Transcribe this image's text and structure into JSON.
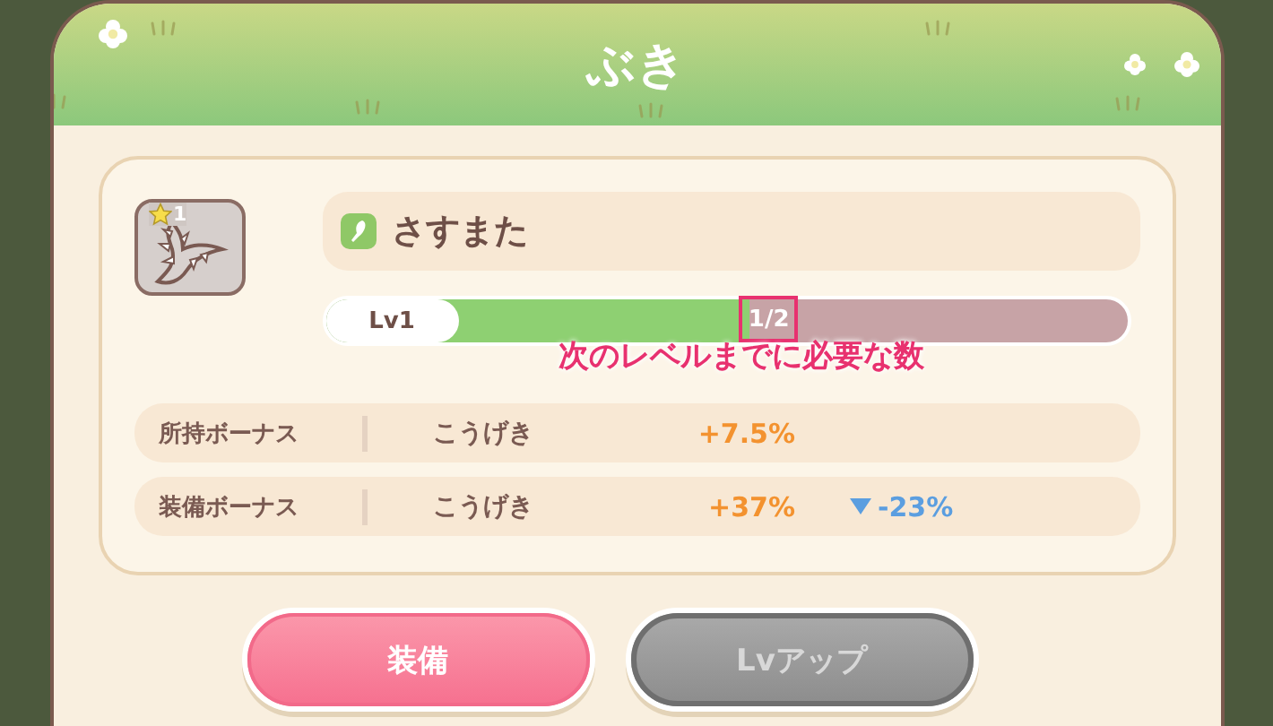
{
  "dialog": {
    "title": "ぶき"
  },
  "item": {
    "rarity": "1",
    "name": "さすまた",
    "level_label": "Lv1",
    "progress": {
      "level": 0.53,
      "count": "1/2",
      "highlighted": true
    },
    "annotation": "次のレベルまでに必要な数"
  },
  "bonuses": [
    {
      "label": "所持ボーナス",
      "stat": "こうげき",
      "value": "+7.5%"
    },
    {
      "label": "装備ボーナス",
      "stat": "こうげき",
      "value": "+37%",
      "change": {
        "decrease": true,
        "value": "-23%"
      }
    }
  ],
  "buttons": [
    {
      "label": "装備",
      "kind": "primary",
      "disabled": false
    },
    {
      "label": "Lvアップ",
      "kind": "secondary",
      "disabled": true
    }
  ]
}
